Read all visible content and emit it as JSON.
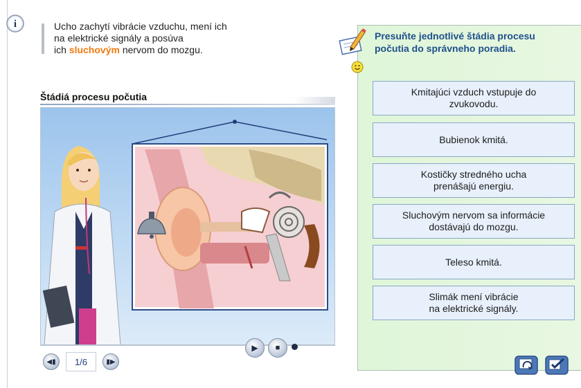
{
  "intro": {
    "line1": "Ucho zachytí vibrácie vzduchu, mení ich",
    "line2": "na elektrické signály a posúva",
    "line3_pre": "ich ",
    "line3_highlight": "sluchovým",
    "line3_post": " nervom do mozgu."
  },
  "section_title": "Štádiá procesu počutia",
  "slideshow": {
    "counter": "1/6"
  },
  "task": {
    "instruction_line1": "Presuňte jednotlivé štádia procesu",
    "instruction_line2": "počutia do správneho poradia."
  },
  "stages": [
    {
      "line1": "Kmitajúci vzduch vstupuje do",
      "line2": "zvukovodu."
    },
    {
      "line1": "Bubienok kmitá.",
      "line2": ""
    },
    {
      "line1": "Kostičky stredného ucha",
      "line2": "prenášajú energiu."
    },
    {
      "line1": "Sluchovým nervom sa informácie",
      "line2": "dostávajú do mozgu."
    },
    {
      "line1": "Teleso kmitá.",
      "line2": ""
    },
    {
      "line1": "Slimák mení vibrácie",
      "line2": "na elektrické signály."
    }
  ],
  "icons": {
    "info": "info-icon",
    "prev": "prev-icon",
    "next": "next-icon",
    "play": "play-icon",
    "stop": "stop-icon",
    "reset": "reset-icon",
    "check": "check-icon",
    "pencil": "pencil-task-icon",
    "smiley": "smiley-icon"
  },
  "colors": {
    "highlight": "#f07a10",
    "instruction": "#1f4f8c",
    "panel_bg": "#dff6d8",
    "stage_bg": "#e7f0fb",
    "scene_bg": "#9cc4ec"
  }
}
